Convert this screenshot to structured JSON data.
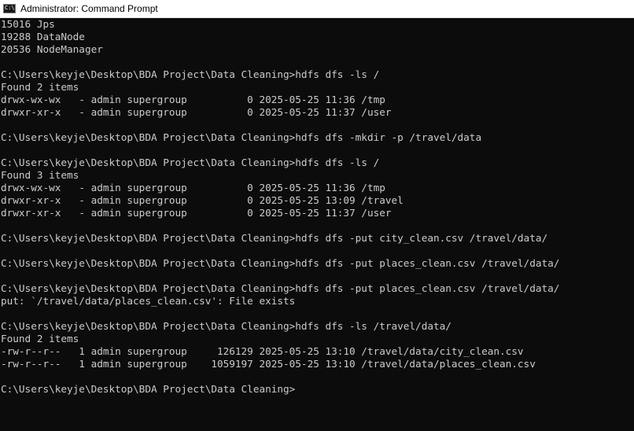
{
  "window": {
    "title": "Administrator: Command Prompt"
  },
  "console": {
    "lines": [
      "15016 Jps",
      "19288 DataNode",
      "20536 NodeManager",
      "",
      "C:\\Users\\keyje\\Desktop\\BDA Project\\Data Cleaning>hdfs dfs -ls /",
      "Found 2 items",
      "drwx-wx-wx   - admin supergroup          0 2025-05-25 11:36 /tmp",
      "drwxr-xr-x   - admin supergroup          0 2025-05-25 11:37 /user",
      "",
      "C:\\Users\\keyje\\Desktop\\BDA Project\\Data Cleaning>hdfs dfs -mkdir -p /travel/data",
      "",
      "C:\\Users\\keyje\\Desktop\\BDA Project\\Data Cleaning>hdfs dfs -ls /",
      "Found 3 items",
      "drwx-wx-wx   - admin supergroup          0 2025-05-25 11:36 /tmp",
      "drwxr-xr-x   - admin supergroup          0 2025-05-25 13:09 /travel",
      "drwxr-xr-x   - admin supergroup          0 2025-05-25 11:37 /user",
      "",
      "C:\\Users\\keyje\\Desktop\\BDA Project\\Data Cleaning>hdfs dfs -put city_clean.csv /travel/data/",
      "",
      "C:\\Users\\keyje\\Desktop\\BDA Project\\Data Cleaning>hdfs dfs -put places_clean.csv /travel/data/",
      "",
      "C:\\Users\\keyje\\Desktop\\BDA Project\\Data Cleaning>hdfs dfs -put places_clean.csv /travel/data/",
      "put: `/travel/data/places_clean.csv': File exists",
      "",
      "C:\\Users\\keyje\\Desktop\\BDA Project\\Data Cleaning>hdfs dfs -ls /travel/data/",
      "Found 2 items",
      "-rw-r--r--   1 admin supergroup     126129 2025-05-25 13:10 /travel/data/city_clean.csv",
      "-rw-r--r--   1 admin supergroup    1059197 2025-05-25 13:10 /travel/data/places_clean.csv",
      "",
      "C:\\Users\\keyje\\Desktop\\BDA Project\\Data Cleaning>"
    ]
  }
}
